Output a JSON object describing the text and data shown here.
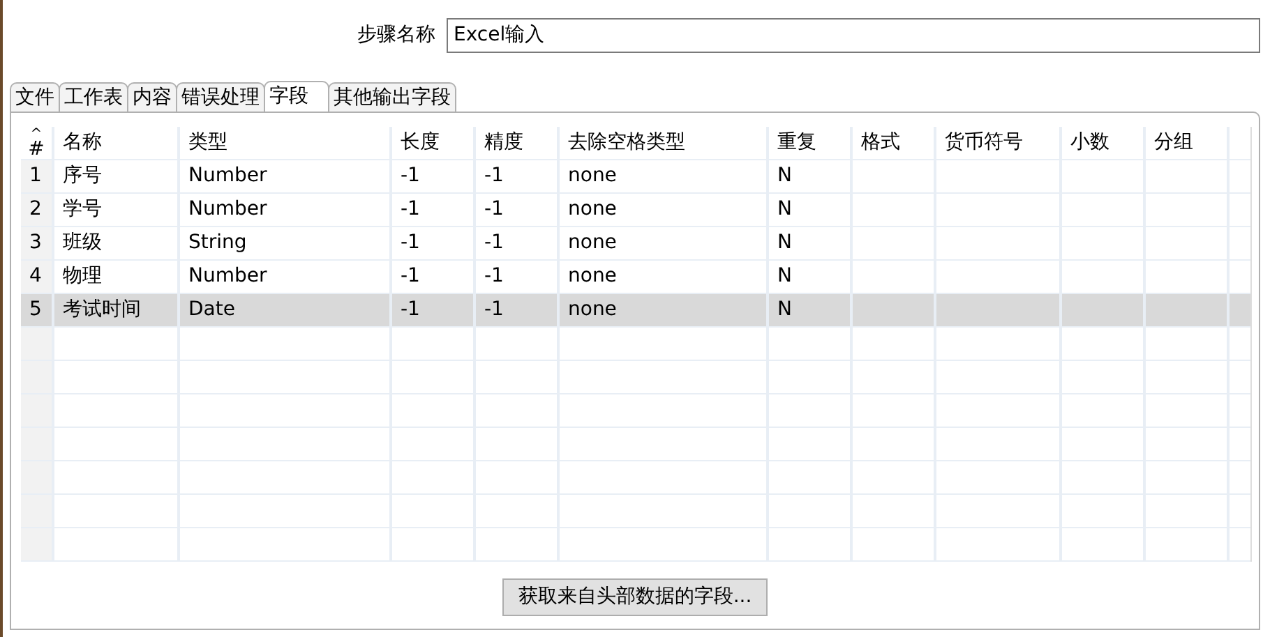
{
  "step_name": {
    "label": "步骤名称",
    "value": "Excel输入"
  },
  "tabs": [
    {
      "label": "文件",
      "selected": false
    },
    {
      "label": "工作表",
      "selected": false
    },
    {
      "label": "内容",
      "selected": false
    },
    {
      "label": "错误处理",
      "selected": false
    },
    {
      "label": "字段",
      "selected": true
    },
    {
      "label": "其他输出字段",
      "selected": false
    }
  ],
  "table": {
    "sort_indicator": "^",
    "columns": [
      "#",
      "名称",
      "类型",
      "长度",
      "精度",
      "去除空格类型",
      "重复",
      "格式",
      "货币符号",
      "小数",
      "分组"
    ],
    "rows": [
      {
        "cells": [
          "1",
          "序号",
          "Number",
          "-1",
          "-1",
          "none",
          "N",
          "",
          "",
          "",
          ""
        ],
        "selected": false
      },
      {
        "cells": [
          "2",
          "学号",
          "Number",
          "-1",
          "-1",
          "none",
          "N",
          "",
          "",
          "",
          ""
        ],
        "selected": false
      },
      {
        "cells": [
          "3",
          "班级",
          "String",
          "-1",
          "-1",
          "none",
          "N",
          "",
          "",
          "",
          ""
        ],
        "selected": false
      },
      {
        "cells": [
          "4",
          "物理",
          "Number",
          "-1",
          "-1",
          "none",
          "N",
          "",
          "",
          "",
          ""
        ],
        "selected": false
      },
      {
        "cells": [
          "5",
          "考试时间",
          "Date",
          "-1",
          "-1",
          "none",
          "N",
          "",
          "",
          "",
          ""
        ],
        "selected": true
      }
    ]
  },
  "button": "获取来自头部数据的字段..."
}
